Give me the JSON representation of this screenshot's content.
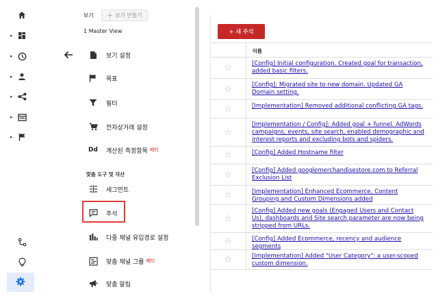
{
  "rail": {
    "items": [
      {
        "name": "home-icon",
        "icon": "home"
      },
      {
        "name": "dashboard-icon",
        "icon": "dashboard",
        "caret": "▸"
      },
      {
        "name": "clock-icon",
        "icon": "realtime",
        "caret": "▸"
      },
      {
        "name": "person-icon",
        "icon": "audience",
        "caret": "▸"
      },
      {
        "name": "acquisition-icon",
        "icon": "acquisition",
        "caret": "▸"
      },
      {
        "name": "behavior-icon",
        "icon": "behavior",
        "caret": "▸"
      },
      {
        "name": "flag-icon",
        "icon": "conversions",
        "caret": "▸"
      }
    ],
    "bottom": [
      {
        "name": "attribution-icon",
        "icon": "attribution"
      },
      {
        "name": "lightbulb-icon",
        "icon": "discover"
      },
      {
        "name": "gear-icon",
        "icon": "admin"
      }
    ]
  },
  "admin": {
    "view_label": "보기",
    "create_view_label": "보기 만들기",
    "create_view_icon": "+",
    "selected_view": "1 Master View",
    "menu": [
      {
        "label": "보기 설정",
        "icon": "doc"
      },
      {
        "label": "목표",
        "icon": "flag"
      },
      {
        "label": "필터",
        "icon": "filter"
      },
      {
        "label": "전자상거래 설정",
        "icon": "cart"
      },
      {
        "label": "계산된 측정항목",
        "icon": "dd",
        "icon_text": "Dd",
        "beta": "베타"
      }
    ],
    "section_title": "맞춤 도구 및 자산",
    "tools": [
      {
        "label": "세그먼트",
        "icon": "segment"
      },
      {
        "label": "주석",
        "icon": "comment"
      },
      {
        "label": "다중 채널 유입경로 설정",
        "icon": "bars"
      },
      {
        "label": "맞춤 채널 그룹",
        "icon": "channel",
        "beta": "베타"
      },
      {
        "label": "맞춤 알림",
        "icon": "megaphone"
      }
    ]
  },
  "annotations": {
    "new_button": "+ 새 주석",
    "column_name": "이름",
    "star_glyph": "☆",
    "rows": [
      "[Config] Initial configuration. Created goal for transaction, added basic filters.",
      "[Config]: Migrated site to new domain. Updated GA Domain setting.",
      "[Implementation] Removed additional conflicting GA tags.",
      "[Implementation / Config]: Added goal + funnel. AdWords campaigns, events, site search, enabled demographic and interest reports and excluding bots and spiders.",
      "[Config] Added Hostname filter",
      "[Config] Added googlemerchandisestore.com to Referral Exclusion List",
      "[Implementation] Enhanced Ecommerce, Content Grouping and Custom Dimensions added",
      "[Config] Added new goals (Engaged Users and Contact Us), dashboards and Site search parameter are now being stripped from URLs.",
      "[Config] Added Ecommerce, recency and audience segments",
      "[Implementation] Added \"User Category\": a user-scoped custom dimension."
    ]
  },
  "colors": {
    "accent_red": "#c62828",
    "highlight": "#e53935",
    "link": "#1a0dab",
    "settings_bg": "#e3ecfa",
    "settings_icon": "#1a73e8"
  }
}
